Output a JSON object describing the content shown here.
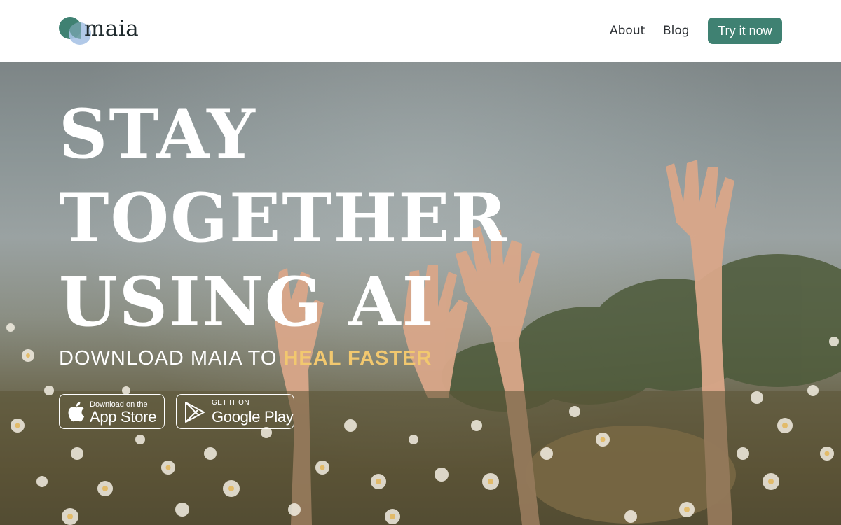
{
  "header": {
    "logo_text": "maia",
    "nav": {
      "about": "About",
      "blog": "Blog"
    },
    "cta_label": "Try it now"
  },
  "hero": {
    "headline": [
      "STAY",
      "TOGETHER",
      "USING AI"
    ],
    "subheading_prefix": "DOWNLOAD MAIA TO ",
    "subheading_highlight": "HEAL FASTER",
    "app_store": {
      "small": "Download on the",
      "big": "App Store"
    },
    "google_play": {
      "small": "GET IT ON",
      "big": "Google Play"
    }
  },
  "colors": {
    "brand_green": "#3f8172",
    "logo_blue": "#a8c3e6",
    "highlight_yellow": "#f2c86f",
    "text_dark": "#2b2f33",
    "white": "#ffffff"
  },
  "icons": [
    "apple-icon",
    "google-play-icon"
  ]
}
